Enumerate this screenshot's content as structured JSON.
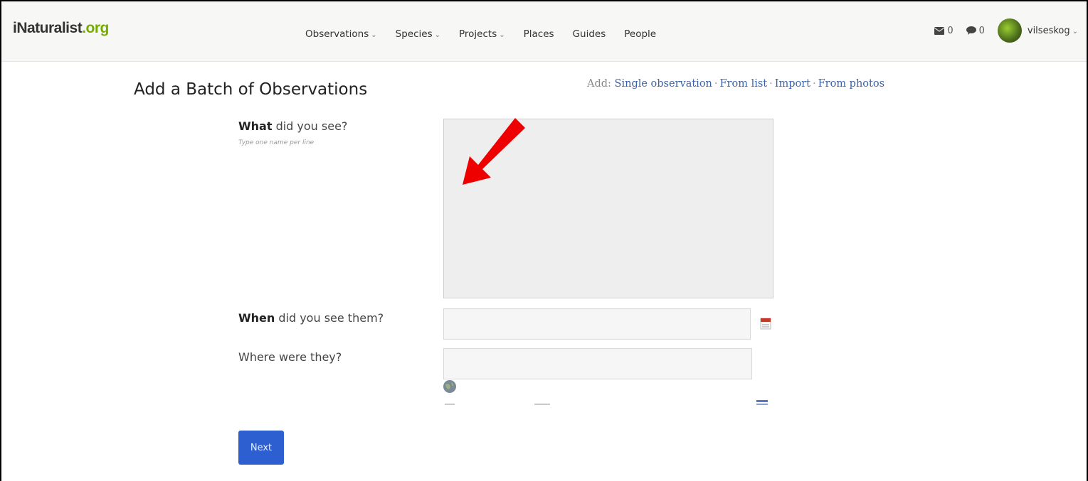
{
  "header": {
    "logo_brand": "iNaturalist",
    "logo_tld": ".org",
    "nav": [
      {
        "label": "Observations",
        "has_dropdown": true
      },
      {
        "label": "Species",
        "has_dropdown": true
      },
      {
        "label": "Projects",
        "has_dropdown": true
      },
      {
        "label": "Places",
        "has_dropdown": false
      },
      {
        "label": "Guides",
        "has_dropdown": false
      },
      {
        "label": "People",
        "has_dropdown": false
      }
    ],
    "messages_count": "0",
    "comments_count": "0",
    "username": "vilseskog"
  },
  "page": {
    "title": "Add a Batch of Observations",
    "add_prefix": "Add:",
    "add_links": [
      "Single observation",
      "From list",
      "Import",
      "From photos"
    ]
  },
  "form": {
    "what_bold": "What",
    "what_rest": " did you see?",
    "what_hint": "Type one name per line",
    "what_value": "",
    "when_bold": "When",
    "when_rest": " did you see them?",
    "when_value": "",
    "where_label": "Where were they?",
    "where_value": "",
    "next_button": "Next"
  },
  "colors": {
    "brand_green": "#74ac00",
    "link_blue": "#3b62a8",
    "button_blue": "#2d5fd0",
    "annotation_arrow": "#ee0000"
  },
  "icons": [
    "envelope-icon",
    "speech-bubble-icon",
    "calendar-icon",
    "globe-icon",
    "chevron-down-icon"
  ]
}
